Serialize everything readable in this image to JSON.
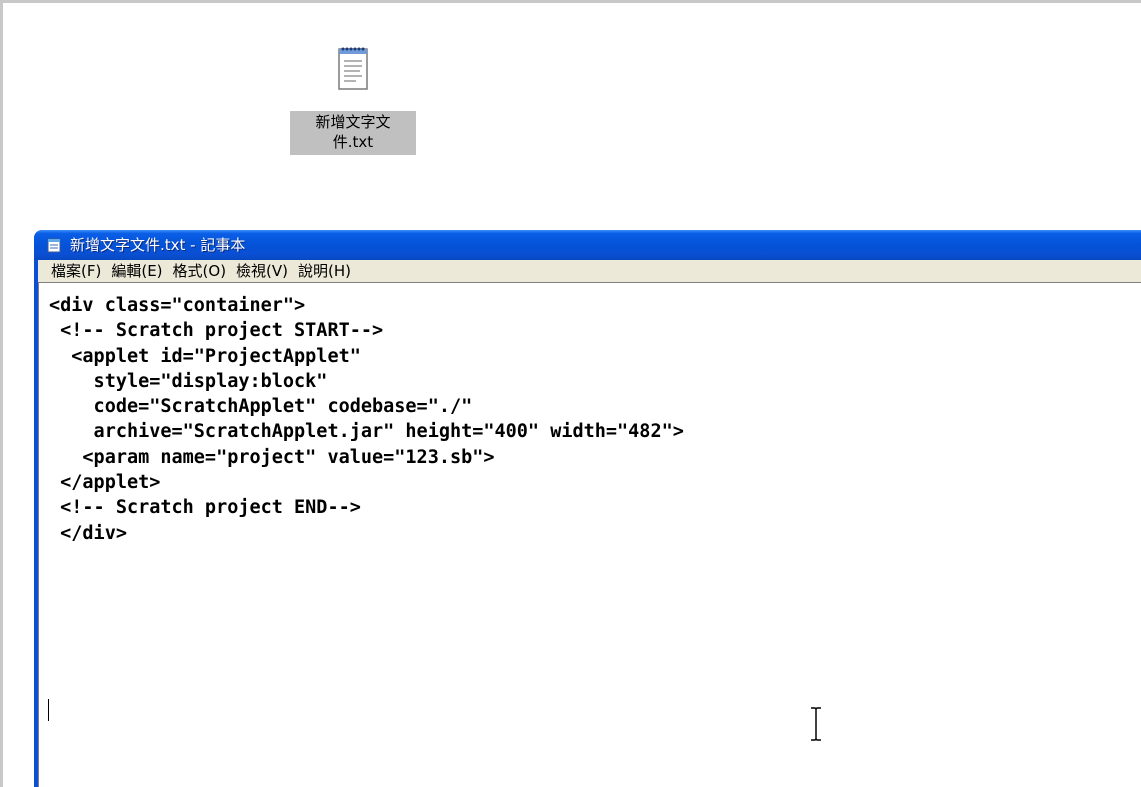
{
  "desktop": {
    "icon": {
      "icon_name": "notepad-text-file-icon",
      "label_line1": "新增文字文",
      "label_line2": "件.txt"
    }
  },
  "window": {
    "title": "新增文字文件.txt - 記事本",
    "title_icon": "notepad-icon",
    "titlebar_color": "#0a4fd4",
    "menu": [
      {
        "label": "檔案(F)"
      },
      {
        "label": "編輯(E)"
      },
      {
        "label": "格式(O)"
      },
      {
        "label": "檢視(V)"
      },
      {
        "label": "說明(H)"
      }
    ]
  },
  "editor": {
    "lines": [
      "<div class=\"container\">",
      " <!-- Scratch project START-->",
      "  <applet id=\"ProjectApplet\"",
      "    style=\"display:block\"",
      "    code=\"ScratchApplet\" codebase=\"./\"",
      "    archive=\"ScratchApplet.jar\" height=\"400\" width=\"482\">",
      "   <param name=\"project\" value=\"123.sb\">",
      " </applet>",
      " <!-- Scratch project END-->",
      " </div>"
    ]
  }
}
